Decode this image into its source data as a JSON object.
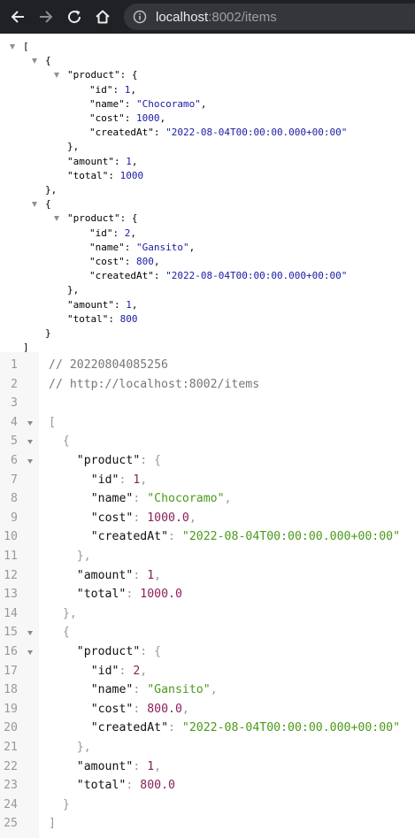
{
  "browser": {
    "url_host": "localhost",
    "url_rest": ":8002/items"
  },
  "tree": {
    "lines": [
      {
        "indent": 0,
        "tri": true,
        "parts": [
          [
            "p",
            "["
          ]
        ]
      },
      {
        "indent": 1,
        "tri": true,
        "parts": [
          [
            "p",
            "{"
          ]
        ]
      },
      {
        "indent": 2,
        "tri": true,
        "parts": [
          [
            "k",
            "\"product\""
          ],
          [
            "p",
            ": {"
          ]
        ]
      },
      {
        "indent": 3,
        "tri": false,
        "parts": [
          [
            "k",
            "\"id\""
          ],
          [
            "p",
            ": "
          ],
          [
            "n",
            "1"
          ],
          [
            "p",
            ","
          ]
        ]
      },
      {
        "indent": 3,
        "tri": false,
        "parts": [
          [
            "k",
            "\"name\""
          ],
          [
            "p",
            ": "
          ],
          [
            "s",
            "\"Chocoramo\""
          ],
          [
            "p",
            ","
          ]
        ]
      },
      {
        "indent": 3,
        "tri": false,
        "parts": [
          [
            "k",
            "\"cost\""
          ],
          [
            "p",
            ": "
          ],
          [
            "n",
            "1000"
          ],
          [
            "p",
            ","
          ]
        ]
      },
      {
        "indent": 3,
        "tri": false,
        "parts": [
          [
            "k",
            "\"createdAt\""
          ],
          [
            "p",
            ": "
          ],
          [
            "s",
            "\"2022-08-04T00:00:00.000+00:00\""
          ]
        ]
      },
      {
        "indent": 2,
        "tri": false,
        "parts": [
          [
            "p",
            "},"
          ]
        ]
      },
      {
        "indent": 2,
        "tri": false,
        "parts": [
          [
            "k",
            "\"amount\""
          ],
          [
            "p",
            ": "
          ],
          [
            "n",
            "1"
          ],
          [
            "p",
            ","
          ]
        ]
      },
      {
        "indent": 2,
        "tri": false,
        "parts": [
          [
            "k",
            "\"total\""
          ],
          [
            "p",
            ": "
          ],
          [
            "n",
            "1000"
          ]
        ]
      },
      {
        "indent": 1,
        "tri": false,
        "parts": [
          [
            "p",
            "},"
          ]
        ]
      },
      {
        "indent": 1,
        "tri": true,
        "parts": [
          [
            "p",
            "{"
          ]
        ]
      },
      {
        "indent": 2,
        "tri": true,
        "parts": [
          [
            "k",
            "\"product\""
          ],
          [
            "p",
            ": {"
          ]
        ]
      },
      {
        "indent": 3,
        "tri": false,
        "parts": [
          [
            "k",
            "\"id\""
          ],
          [
            "p",
            ": "
          ],
          [
            "n",
            "2"
          ],
          [
            "p",
            ","
          ]
        ]
      },
      {
        "indent": 3,
        "tri": false,
        "parts": [
          [
            "k",
            "\"name\""
          ],
          [
            "p",
            ": "
          ],
          [
            "s",
            "\"Gansito\""
          ],
          [
            "p",
            ","
          ]
        ]
      },
      {
        "indent": 3,
        "tri": false,
        "parts": [
          [
            "k",
            "\"cost\""
          ],
          [
            "p",
            ": "
          ],
          [
            "n",
            "800"
          ],
          [
            "p",
            ","
          ]
        ]
      },
      {
        "indent": 3,
        "tri": false,
        "parts": [
          [
            "k",
            "\"createdAt\""
          ],
          [
            "p",
            ": "
          ],
          [
            "s",
            "\"2022-08-04T00:00:00.000+00:00\""
          ]
        ]
      },
      {
        "indent": 2,
        "tri": false,
        "parts": [
          [
            "p",
            "},"
          ]
        ]
      },
      {
        "indent": 2,
        "tri": false,
        "parts": [
          [
            "k",
            "\"amount\""
          ],
          [
            "p",
            ": "
          ],
          [
            "n",
            "1"
          ],
          [
            "p",
            ","
          ]
        ]
      },
      {
        "indent": 2,
        "tri": false,
        "parts": [
          [
            "k",
            "\"total\""
          ],
          [
            "p",
            ": "
          ],
          [
            "n",
            "800"
          ]
        ]
      },
      {
        "indent": 1,
        "tri": false,
        "parts": [
          [
            "p",
            "}"
          ]
        ]
      },
      {
        "indent": 0,
        "tri": false,
        "parts": [
          [
            "p",
            "]"
          ]
        ]
      }
    ]
  },
  "editor": {
    "lines": [
      {
        "n": "1",
        "fold": false,
        "indent": 0,
        "parts": [
          [
            "c",
            "// 20220804085256"
          ]
        ]
      },
      {
        "n": "2",
        "fold": false,
        "indent": 0,
        "parts": [
          [
            "c",
            "// http://localhost:8002/items"
          ]
        ]
      },
      {
        "n": "3",
        "fold": false,
        "indent": 0,
        "parts": []
      },
      {
        "n": "4",
        "fold": true,
        "indent": 0,
        "parts": [
          [
            "p",
            "["
          ]
        ]
      },
      {
        "n": "5",
        "fold": true,
        "indent": 1,
        "parts": [
          [
            "p",
            "{"
          ]
        ]
      },
      {
        "n": "6",
        "fold": true,
        "indent": 2,
        "parts": [
          [
            "k",
            "\"product\""
          ],
          [
            "p",
            ": {"
          ]
        ]
      },
      {
        "n": "7",
        "fold": false,
        "indent": 3,
        "parts": [
          [
            "k",
            "\"id\""
          ],
          [
            "p",
            ": "
          ],
          [
            "n",
            "1"
          ],
          [
            "p",
            ","
          ]
        ]
      },
      {
        "n": "8",
        "fold": false,
        "indent": 3,
        "parts": [
          [
            "k",
            "\"name\""
          ],
          [
            "p",
            ": "
          ],
          [
            "s",
            "\"Chocoramo\""
          ],
          [
            "p",
            ","
          ]
        ]
      },
      {
        "n": "9",
        "fold": false,
        "indent": 3,
        "parts": [
          [
            "k",
            "\"cost\""
          ],
          [
            "p",
            ": "
          ],
          [
            "n",
            "1000.0"
          ],
          [
            "p",
            ","
          ]
        ]
      },
      {
        "n": "10",
        "fold": false,
        "indent": 3,
        "parts": [
          [
            "k",
            "\"createdAt\""
          ],
          [
            "p",
            ": "
          ],
          [
            "s",
            "\"2022-08-04T00:00:00.000+00:00\""
          ]
        ]
      },
      {
        "n": "11",
        "fold": false,
        "indent": 2,
        "parts": [
          [
            "p",
            "},"
          ]
        ]
      },
      {
        "n": "12",
        "fold": false,
        "indent": 2,
        "parts": [
          [
            "k",
            "\"amount\""
          ],
          [
            "p",
            ": "
          ],
          [
            "n",
            "1"
          ],
          [
            "p",
            ","
          ]
        ]
      },
      {
        "n": "13",
        "fold": false,
        "indent": 2,
        "parts": [
          [
            "k",
            "\"total\""
          ],
          [
            "p",
            ": "
          ],
          [
            "n",
            "1000.0"
          ]
        ]
      },
      {
        "n": "14",
        "fold": false,
        "indent": 1,
        "parts": [
          [
            "p",
            "},"
          ]
        ]
      },
      {
        "n": "15",
        "fold": true,
        "indent": 1,
        "parts": [
          [
            "p",
            "{"
          ]
        ]
      },
      {
        "n": "16",
        "fold": true,
        "indent": 2,
        "parts": [
          [
            "k",
            "\"product\""
          ],
          [
            "p",
            ": {"
          ]
        ]
      },
      {
        "n": "17",
        "fold": false,
        "indent": 3,
        "parts": [
          [
            "k",
            "\"id\""
          ],
          [
            "p",
            ": "
          ],
          [
            "n",
            "2"
          ],
          [
            "p",
            ","
          ]
        ]
      },
      {
        "n": "18",
        "fold": false,
        "indent": 3,
        "parts": [
          [
            "k",
            "\"name\""
          ],
          [
            "p",
            ": "
          ],
          [
            "s",
            "\"Gansito\""
          ],
          [
            "p",
            ","
          ]
        ]
      },
      {
        "n": "19",
        "fold": false,
        "indent": 3,
        "parts": [
          [
            "k",
            "\"cost\""
          ],
          [
            "p",
            ": "
          ],
          [
            "n",
            "800.0"
          ],
          [
            "p",
            ","
          ]
        ]
      },
      {
        "n": "20",
        "fold": false,
        "indent": 3,
        "parts": [
          [
            "k",
            "\"createdAt\""
          ],
          [
            "p",
            ": "
          ],
          [
            "s",
            "\"2022-08-04T00:00:00.000+00:00\""
          ]
        ]
      },
      {
        "n": "21",
        "fold": false,
        "indent": 2,
        "parts": [
          [
            "p",
            "},"
          ]
        ]
      },
      {
        "n": "22",
        "fold": false,
        "indent": 2,
        "parts": [
          [
            "k",
            "\"amount\""
          ],
          [
            "p",
            ": "
          ],
          [
            "n",
            "1"
          ],
          [
            "p",
            ","
          ]
        ]
      },
      {
        "n": "23",
        "fold": false,
        "indent": 2,
        "parts": [
          [
            "k",
            "\"total\""
          ],
          [
            "p",
            ": "
          ],
          [
            "n",
            "800.0"
          ]
        ]
      },
      {
        "n": "24",
        "fold": false,
        "indent": 1,
        "parts": [
          [
            "p",
            "}"
          ]
        ]
      },
      {
        "n": "25",
        "fold": false,
        "indent": 0,
        "parts": [
          [
            "p",
            "]"
          ]
        ]
      }
    ]
  }
}
